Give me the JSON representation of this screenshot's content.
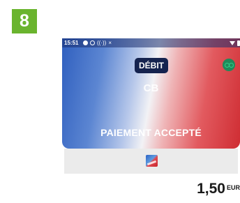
{
  "step_badge": {
    "label": "8",
    "color": "#6ab42e"
  },
  "status_bar": {
    "time": "15:51",
    "left_icons": [
      "notification-dot-icon",
      "check-circle-icon",
      "nfc-icon",
      "close-icon"
    ],
    "right_icons": [
      "wifi-icon",
      "battery-icon"
    ]
  },
  "payment": {
    "card_type": "DÉBIT",
    "network": "CB",
    "result": "PAIEMENT ACCEPTÉ",
    "amount": "1,50",
    "currency": "EUR"
  },
  "colors": {
    "gradient_blue": "#2f5fbf",
    "gradient_red": "#cf2d33",
    "debit_chip": "#15234f",
    "menu_button": "#1f8a5a"
  }
}
